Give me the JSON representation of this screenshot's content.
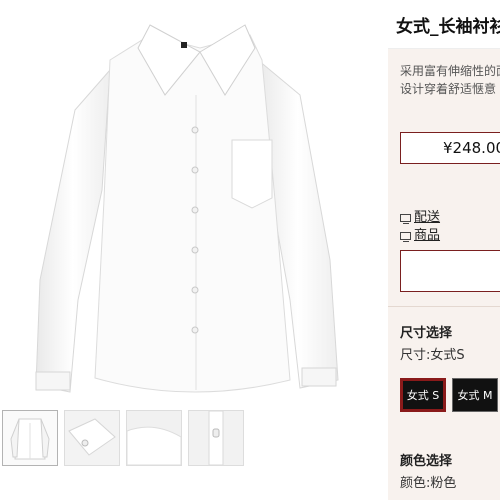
{
  "product": {
    "title": "女式_长袖衬衫",
    "description_lines": [
      "采用富有伸缩性的面料",
      "设计穿着舒适惬意"
    ],
    "price": "¥248.00"
  },
  "links": [
    {
      "icon": "chat-icon",
      "label": "配送"
    },
    {
      "icon": "chat-icon",
      "label": "商品"
    }
  ],
  "size": {
    "heading": "尺寸选择",
    "current": "尺寸:女式S",
    "options": [
      {
        "label": "女式 S",
        "selected": true
      },
      {
        "label": "女式 M",
        "selected": false
      }
    ]
  },
  "color": {
    "heading": "颜色选择",
    "current": "颜色:粉色"
  },
  "gallery": {
    "thumbnail_count": 4,
    "active_thumbnail": 1
  }
}
